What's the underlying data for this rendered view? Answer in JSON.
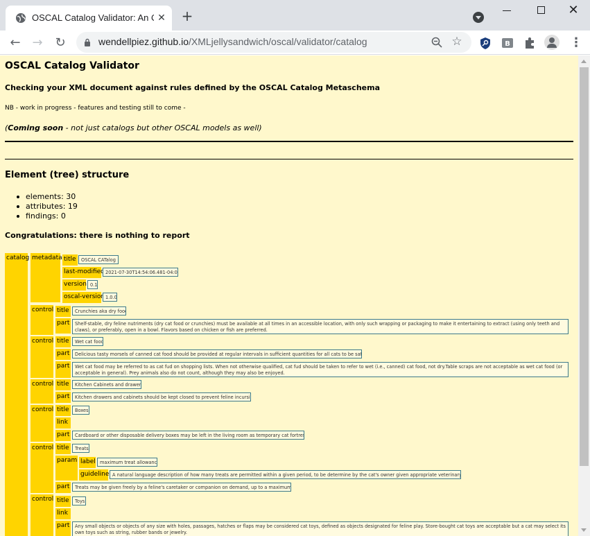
{
  "browser": {
    "tab_title": "OSCAL Catalog Validator: An OSCAL",
    "tab_close": "✕",
    "new_tab": "+",
    "url_host": "wendellpiez.github.io",
    "url_path": "/XMLjellysandwich/oscal/validator/catalog",
    "back": "←",
    "forward": "→",
    "reload": "↻",
    "star": "☆",
    "menu": "⋮",
    "win_close": "✕"
  },
  "page": {
    "title": "OSCAL Catalog Validator",
    "subtitle": "Checking your XML document against rules defined by the OSCAL Catalog Metaschema",
    "nb": "NB - work in progress - features and testing still to come -",
    "coming_soon_bold": "Coming soon",
    "coming_soon_rest": " - not just catalogs but other OSCAL models as well)",
    "coming_soon_open": "(",
    "structure_heading": "Element (tree) structure",
    "stats": [
      "elements: 30",
      "attributes: 19",
      "findings: 0"
    ],
    "congrats": "Congratulations: there is nothing to report"
  },
  "tree": {
    "catalog": "catalog",
    "metadata": {
      "tag": "metadata",
      "title_tag": "title",
      "title": "OSCAL CATalog",
      "last_modified_tag": "last-modified",
      "last_modified": "2021-07-30T14:54:06.481-04:00",
      "version_tag": "version",
      "version": "0.1",
      "oscal_version_tag": "oscal-version",
      "oscal_version": "1.0.0"
    },
    "controls": [
      {
        "tag": "control",
        "title_tag": "title",
        "title": "Crunchies aka dry food",
        "parts": [
          "Shelf-stable, dry feline nutriments (dry cat food or crunchies) must be available at all times in an accessible location, with only such wrapping or packaging to make it entertaining to extract (using only teeth and claws), or preferably, open in a bowl. Flavors based on chicken or fish are preferred."
        ]
      },
      {
        "tag": "control",
        "title_tag": "title",
        "title": "Wet cat food",
        "parts": [
          "Delicious tasty morsels of canned cat food should be provided at regular intervals in sufficient quantities for all cats to be satisfied.",
          "Wet cat food may be referred to as cat fud on shopping lists. When not otherwise qualified, cat fud should be taken to refer to wet (i.e., canned) cat food, not dry.Table scraps are not acceptable as wet cat food (or acceptable in general). Prey animals also do not count, although they may also be enjoyed."
        ]
      },
      {
        "tag": "control",
        "title_tag": "title",
        "title": "Kitchen Cabinets and drawers",
        "parts": [
          "Kitchen drawers and cabinets should be kept closed to prevent feline incursion."
        ]
      },
      {
        "tag": "control",
        "title_tag": "title",
        "title": "Boxes",
        "link_tag": "link",
        "parts": [
          "Cardboard or other disposable delivery boxes may be left in the living room as temporary cat fortresses."
        ]
      },
      {
        "tag": "control",
        "title_tag": "title",
        "title": "Treats",
        "param_tag": "param",
        "label_tag": "label",
        "label": "maximum treat allowance",
        "guideline_tag": "guideline",
        "guideline": "A natural language description of how many treats are permitted within a given period, to be determine by the cat's owner given appropriate veterinary advice.",
        "parts": [
          "Treats may be given freely by a feline's caretaker or companion on demand, up to a maximum of ."
        ]
      },
      {
        "tag": "control",
        "title_tag": "title",
        "title": "Toys",
        "link_tag": "link",
        "parts": [
          "Any small objects or objects of any size with holes, passages, hatches or flaps may be considered cat toys, defined as objects designated for feline play. Store-bought cat toys are acceptable but a cat may select its own toys such as string, rubber bands or jewelry."
        ]
      }
    ],
    "part_tag": "part"
  }
}
